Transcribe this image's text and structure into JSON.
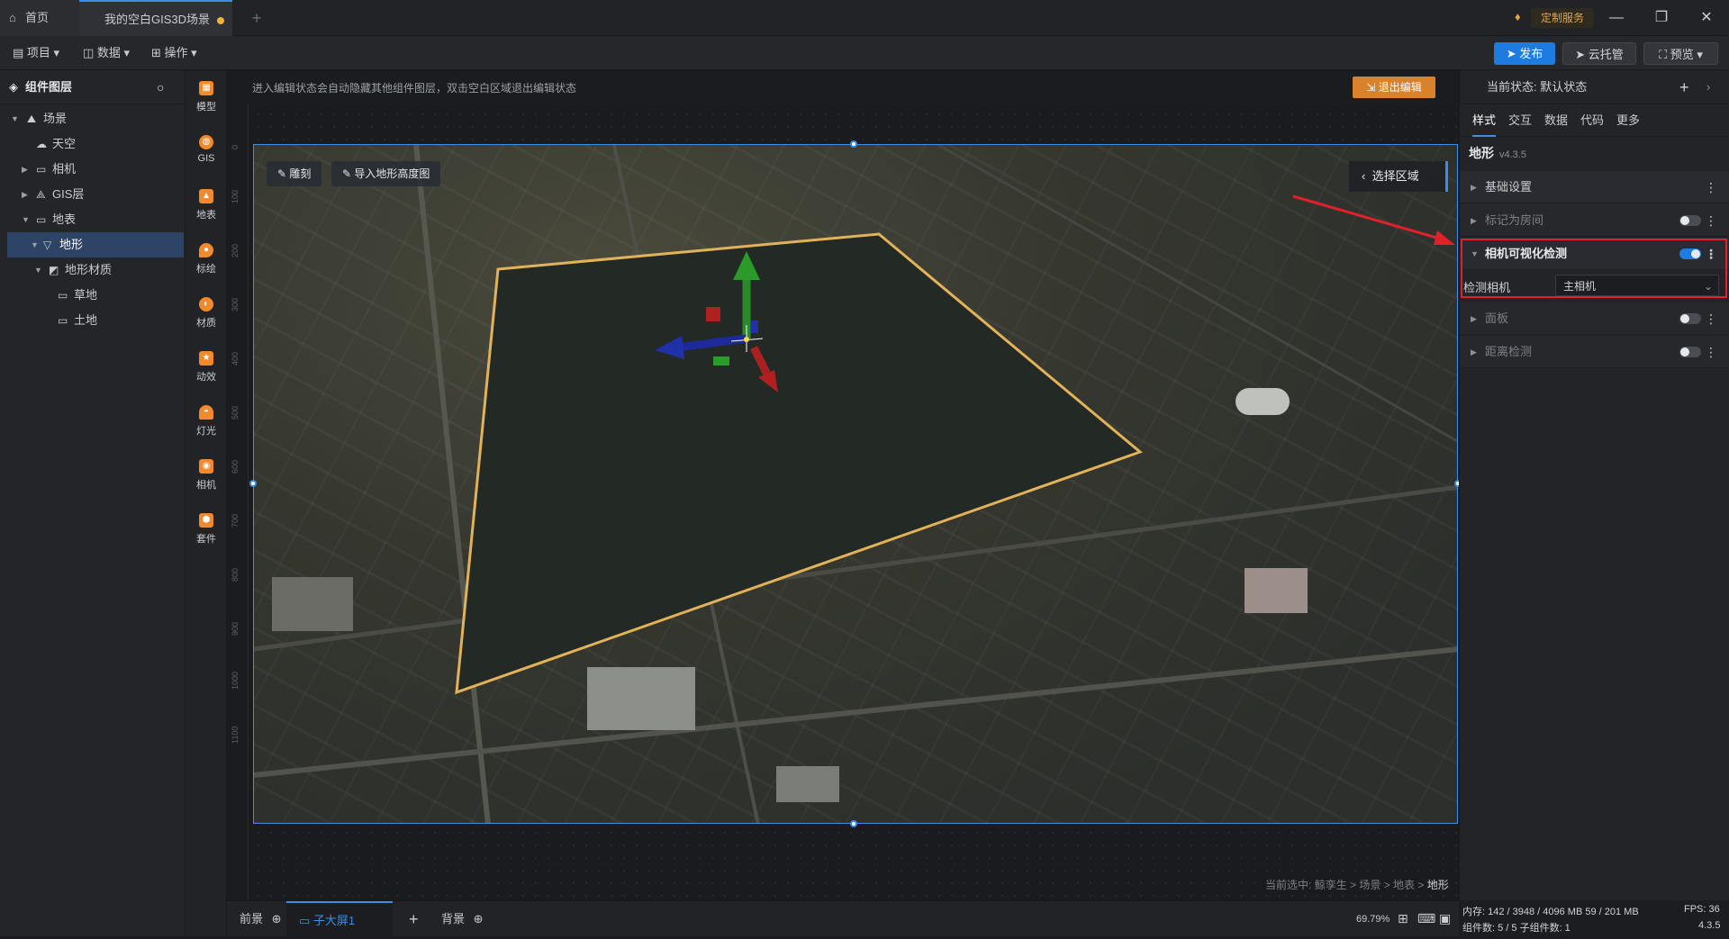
{
  "titlebar": {
    "home_tab": "首页",
    "doc_tab": "我的空白GIS3D场景",
    "custom_service": "定制服务",
    "minimize": "—",
    "restore": "❐",
    "close": "✕"
  },
  "toolbar": {
    "project": "项目",
    "data": "数据",
    "operate": "操作",
    "publish": "发布",
    "cloud": "云托管",
    "preview": "预览"
  },
  "layers": {
    "title": "组件图层",
    "items": [
      {
        "label": "场景"
      },
      {
        "label": "天空"
      },
      {
        "label": "相机"
      },
      {
        "label": "GIS层"
      },
      {
        "label": "地表"
      },
      {
        "label": "地形"
      },
      {
        "label": "地形材质"
      },
      {
        "label": "草地"
      },
      {
        "label": "土地"
      }
    ]
  },
  "rail": {
    "items": [
      {
        "label": "模型"
      },
      {
        "label": "GIS"
      },
      {
        "label": "地表"
      },
      {
        "label": "标绘"
      },
      {
        "label": "材质"
      },
      {
        "label": "动效"
      },
      {
        "label": "灯光"
      },
      {
        "label": "相机"
      },
      {
        "label": "套件"
      }
    ]
  },
  "canvas": {
    "hint": "进入编辑状态会自动隐藏其他组件图层，双击空白区域退出编辑状态",
    "exit_edit": "退出编辑",
    "sculpt": "雕刻",
    "import_heightmap": "导入地形高度图",
    "select_region": "选择区域",
    "breadcrumb_prefix": "当前选中:",
    "breadcrumb_path": "鲸孪生 > 场景 > 地表 >",
    "breadcrumb_current": "地形",
    "ruler_ticks": [
      "0",
      "100",
      "200",
      "300",
      "400",
      "500",
      "600",
      "700",
      "800",
      "900",
      "1000",
      "1100"
    ]
  },
  "bottombar": {
    "foreground": "前景",
    "subscreen": "子大屏1",
    "background": "背景",
    "zoom": "69.79%"
  },
  "props": {
    "state_label": "当前状态:",
    "state_value": "默认状态",
    "tabs": [
      "样式",
      "交互",
      "数据",
      "代码",
      "更多"
    ],
    "component_name": "地形",
    "component_version": "v4.3.5",
    "sections": {
      "basic": "基础设置",
      "mark_room": "标记为房间",
      "camera_visibility": "相机可视化检测",
      "panel": "面板",
      "distance": "距离检测"
    },
    "detect_camera_label": "检测相机",
    "detect_camera_value": "主相机"
  },
  "footer": {
    "memory": "内存: 142 / 3948 / 4096 MB  59 / 201 MB",
    "fps": "FPS: 36",
    "components": "组件数: 5 / 5   子组件数: 1",
    "version": "4.3.5"
  }
}
